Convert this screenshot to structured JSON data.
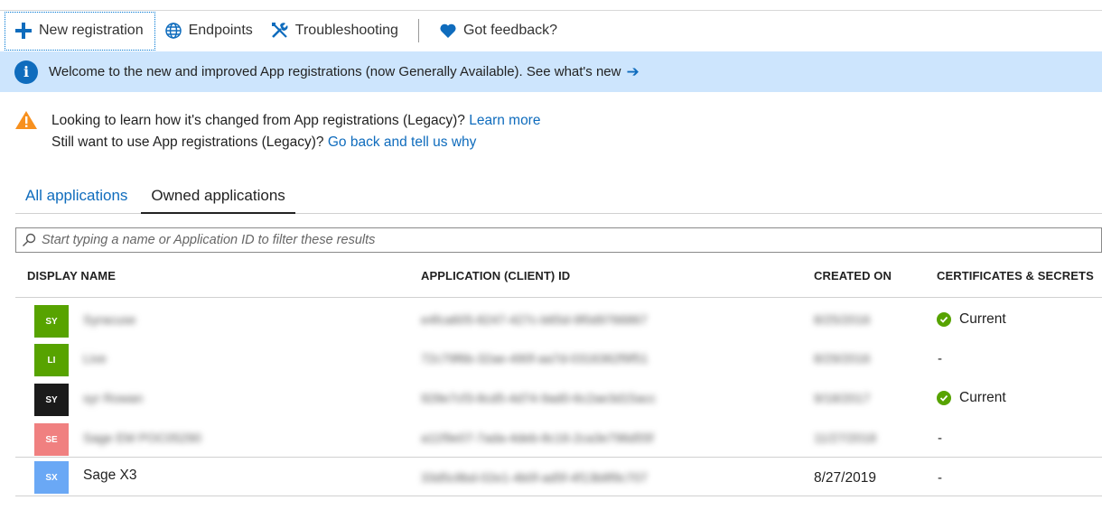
{
  "toolbar": {
    "new_registration": "New registration",
    "endpoints": "Endpoints",
    "troubleshooting": "Troubleshooting",
    "feedback": "Got feedback?"
  },
  "banner": {
    "text": "Welcome to the new and improved App registrations (now Generally Available). See what's new"
  },
  "legacy": {
    "line1_text": "Looking to learn how it's changed from App registrations (Legacy)?",
    "line1_link": "Learn more",
    "line2_text": "Still want to use App registrations (Legacy)?",
    "line2_link": "Go back and tell us why"
  },
  "tabs": {
    "all": "All applications",
    "owned": "Owned applications"
  },
  "search": {
    "placeholder": "Start typing a name or Application ID to filter these results"
  },
  "table": {
    "headers": {
      "name": "DISPLAY NAME",
      "client_id": "APPLICATION (CLIENT) ID",
      "created": "CREATED ON",
      "certs": "CERTIFICATES & SECRETS"
    },
    "rows": [
      {
        "initials": "SY",
        "avatar_color": "#57a300",
        "name": "Syracuse",
        "client_id": "e4fca605-8247-427c-b65d-9f0d9766867",
        "created": "8/25/2016",
        "certs": "Current"
      },
      {
        "initials": "LI",
        "avatar_color": "#57a300",
        "name": "Live",
        "client_id": "72c79f6b-32ae-490f-aa7d-0316362f9f51",
        "created": "8/29/2016",
        "certs": "-"
      },
      {
        "initials": "SY",
        "avatar_color": "#1b1b1b",
        "name": "syr Rowan",
        "client_id": "928e7cf3-8cd5-4d74-9ad0-6c2ae3d15acc",
        "created": "9/18/2017",
        "certs": "Current"
      },
      {
        "initials": "SE",
        "avatar_color": "#f08080",
        "name": "Sage EM POC05290",
        "client_id": "a11f9e07-7ada-4deb-8c16-2ca3e796d55f",
        "created": "11/27/2018",
        "certs": "-"
      },
      {
        "initials": "SX",
        "avatar_color": "#6aa8f5",
        "name": "Sage X3",
        "client_id": "33d5c8bd-02e1-4b0f-ad5f-4f13b8f9c707",
        "created": "8/27/2019",
        "certs": "-"
      }
    ]
  },
  "colors": {
    "accent": "#0f6cbd",
    "banner_bg": "#cde5fd",
    "warning": "#f7901e",
    "success": "#57a300"
  }
}
